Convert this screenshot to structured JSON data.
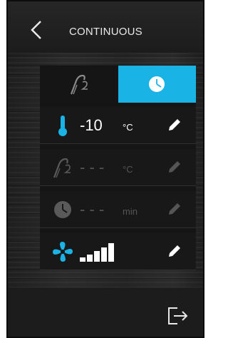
{
  "header": {
    "title": "CONTINUOUS",
    "back_icon": "chevron-left-icon"
  },
  "tabs": [
    {
      "name": "probe",
      "icon": "core-probe-icon",
      "selected": false
    },
    {
      "name": "timer",
      "icon": "clock-icon",
      "selected": true
    }
  ],
  "rows": {
    "temperature": {
      "icon": "thermometer-icon",
      "value": "-10",
      "unit": "°C",
      "active": true
    },
    "probe": {
      "icon": "core-probe-icon",
      "value": "- - -",
      "unit": "°C",
      "active": false
    },
    "time": {
      "icon": "clock-icon",
      "value": "- - -",
      "unit": "min",
      "active": false
    },
    "fan": {
      "icon": "fan-icon",
      "level": 5,
      "max_level": 5,
      "active": true
    }
  },
  "footer": {
    "exit_icon": "exit-icon"
  },
  "colors": {
    "accent": "#1ab3e6",
    "background": "#1b1b1b",
    "panel": "#151515",
    "dim_text": "#555555",
    "text": "#ffffff"
  }
}
